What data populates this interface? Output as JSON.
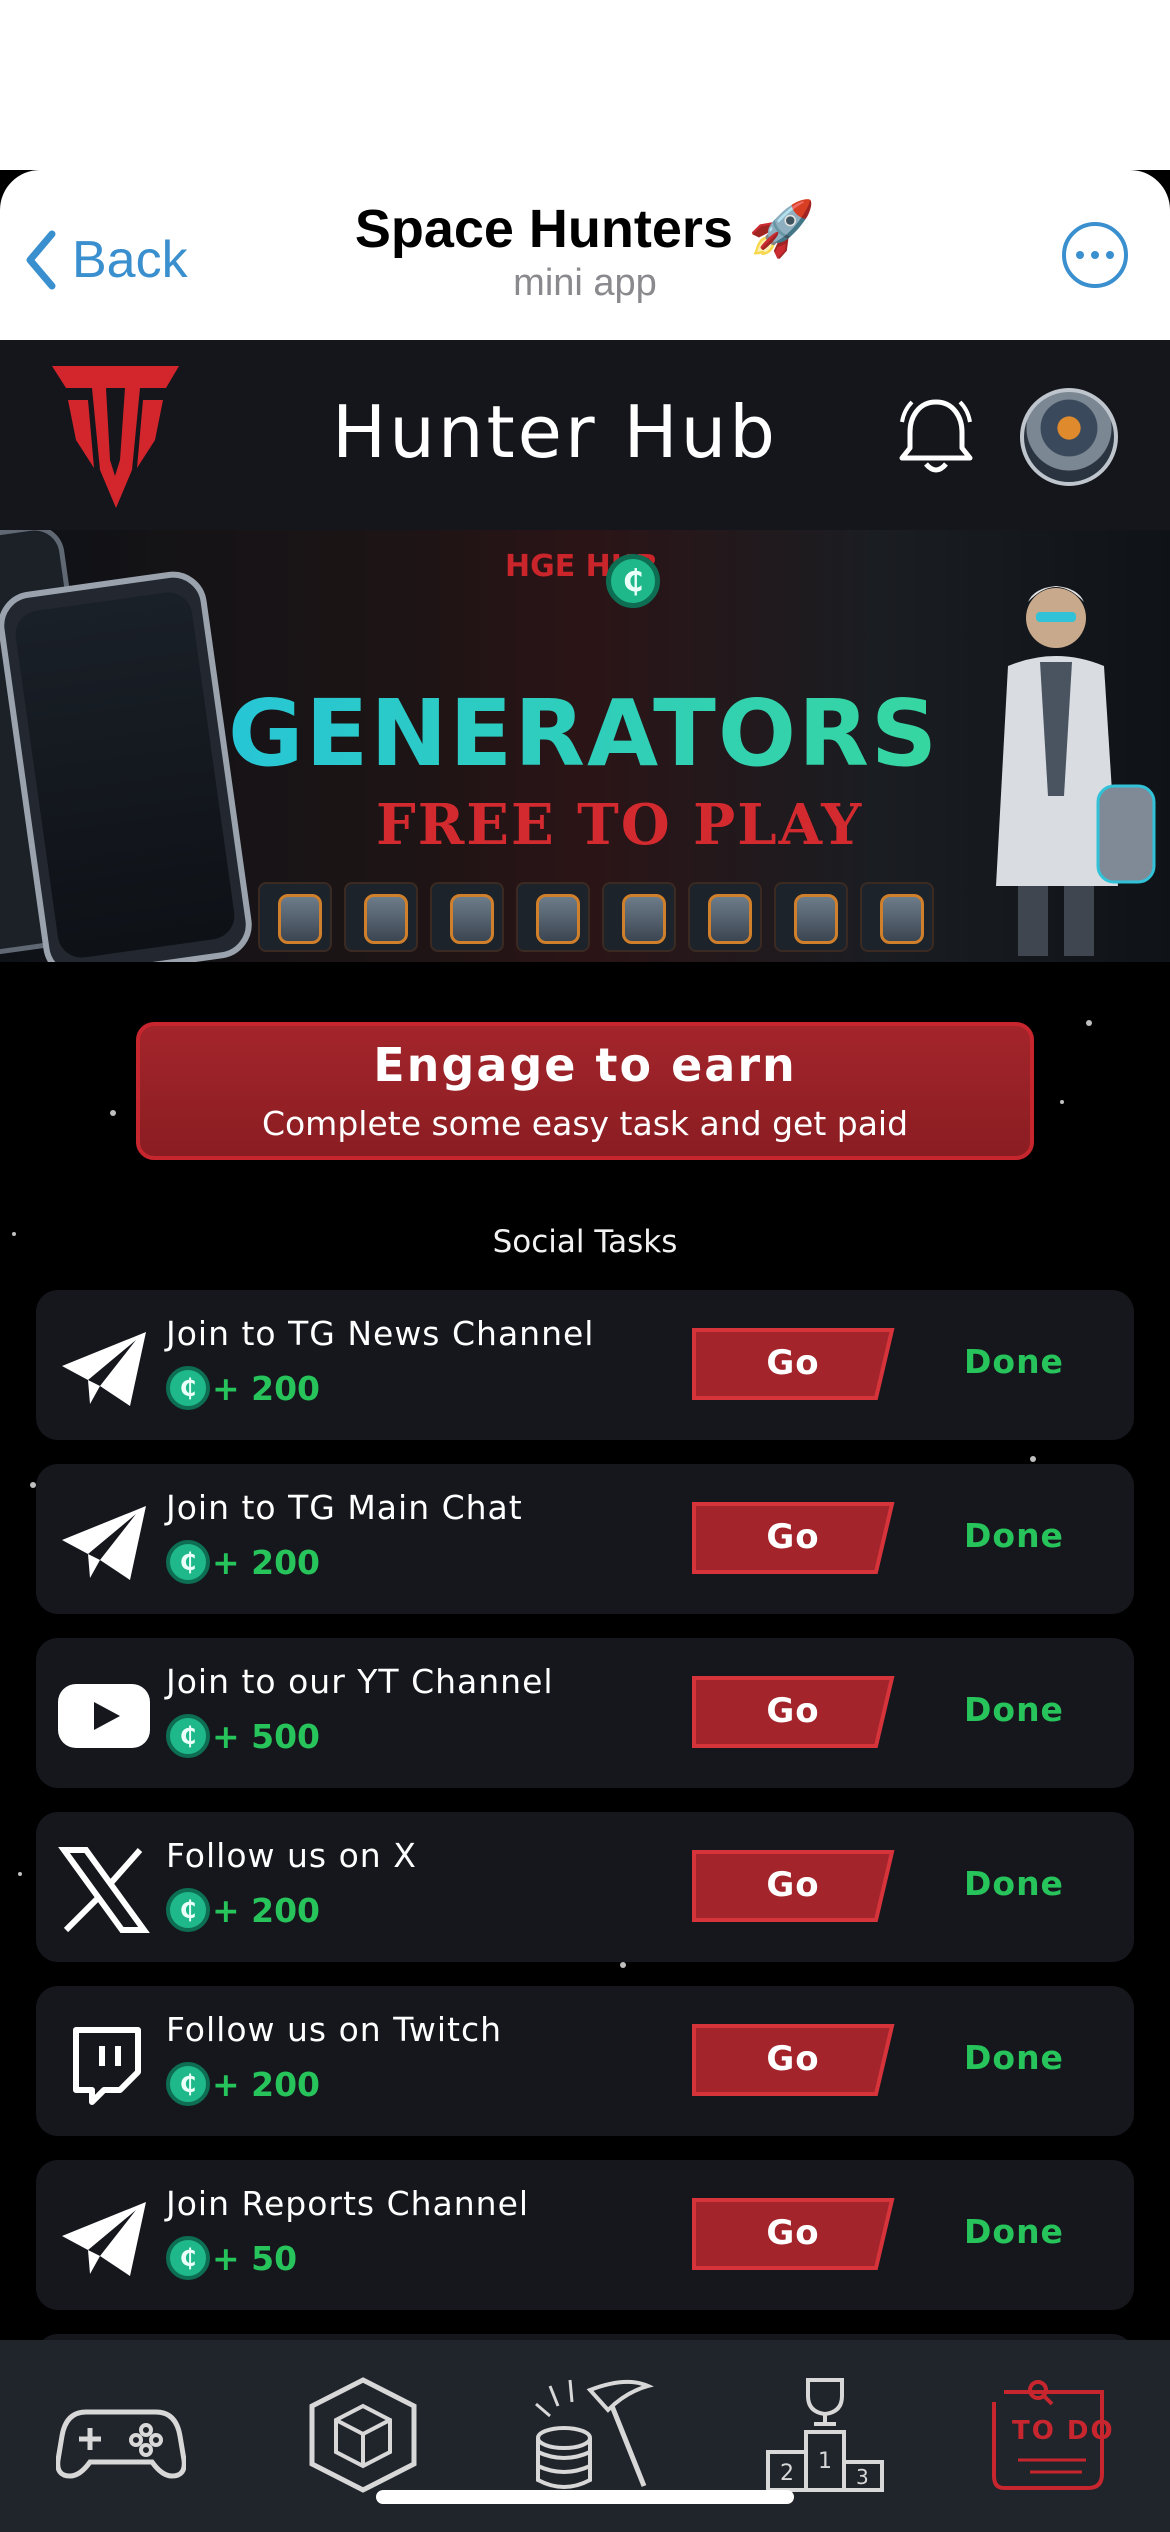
{
  "telegram": {
    "back_label": "Back",
    "title": "Space Hunters 🚀",
    "subtitle": "mini app"
  },
  "app": {
    "title": "Hunter Hub"
  },
  "banner": {
    "badge": "HGE HUB",
    "headline": "GENERATORS",
    "tagline": "FREE TO PLAY"
  },
  "engage": {
    "title": "Engage to earn",
    "subtitle": "Complete some easy task and get paid"
  },
  "section_label": "Social Tasks",
  "tasks": [
    {
      "title": "Join to TG News Channel",
      "reward": "+ 200",
      "icon": "telegram-icon",
      "go": "Go",
      "status": "Done"
    },
    {
      "title": "Join to TG Main Chat",
      "reward": "+ 200",
      "icon": "telegram-icon",
      "go": "Go",
      "status": "Done"
    },
    {
      "title": "Join to our YT Channel",
      "reward": "+ 500",
      "icon": "youtube-icon",
      "go": "Go",
      "status": "Done"
    },
    {
      "title": "Follow us on X",
      "reward": "+ 200",
      "icon": "x-icon",
      "go": "Go",
      "status": "Done"
    },
    {
      "title": "Follow us on Twitch",
      "reward": "+ 200",
      "icon": "twitch-icon",
      "go": "Go",
      "status": "Done"
    },
    {
      "title": "Join Reports Channel",
      "reward": "+ 50",
      "icon": "telegram-icon",
      "go": "Go",
      "status": "Done"
    }
  ],
  "bottom_nav": [
    {
      "icon": "gamepad-icon"
    },
    {
      "icon": "cube-icon"
    },
    {
      "icon": "mining-icon"
    },
    {
      "icon": "leaderboard-icon"
    },
    {
      "icon": "todo-icon",
      "label": "TO DO",
      "active": true
    }
  ],
  "colors": {
    "accent_red": "#c7262e",
    "reward_green": "#27c35b",
    "coin_teal": "#1fb88a",
    "card_bg": "#15171d",
    "tg_link_blue": "#3a8fcf"
  }
}
